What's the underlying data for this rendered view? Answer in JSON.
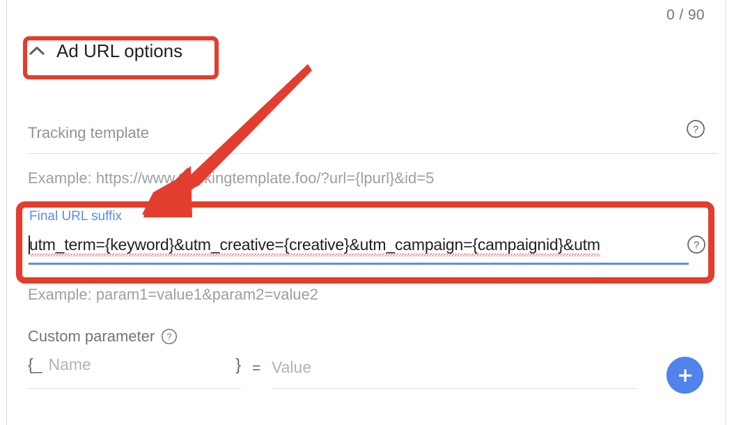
{
  "counter": {
    "text": "0 / 90"
  },
  "section": {
    "title": "Ad URL options",
    "chevron_icon": "chevron-up-icon"
  },
  "tracking_template": {
    "label": "Tracking template",
    "placeholder": "Tracking template",
    "value": "",
    "example": "Example: https://www.trackingtemplate.foo/?url={lpurl}&id=5",
    "help_icon": "help-circle-icon"
  },
  "final_url_suffix": {
    "label": "Final URL suffix",
    "value": "utm_term={keyword}&utm_creative={creative}&utm_campaign={campaignid}&utm",
    "example": "Example: param1=value1&param2=value2",
    "help_icon": "help-circle-icon",
    "focused": true
  },
  "custom_parameter": {
    "label": "Custom parameter",
    "help_icon": "help-circle-icon",
    "name_prefix": "{_",
    "name_placeholder": "Name",
    "name_suffix": "}",
    "equals": "=",
    "value_placeholder": "Value",
    "add_button_icon": "plus-icon"
  },
  "colors": {
    "accent_blue": "#5083ec",
    "label_blue": "#5b8def",
    "annotation_red": "#e23d2e",
    "text_primary": "#202124",
    "text_secondary": "#70757a",
    "placeholder_gray": "#9aa0a6",
    "spellcheck_red": "#e8776a"
  }
}
